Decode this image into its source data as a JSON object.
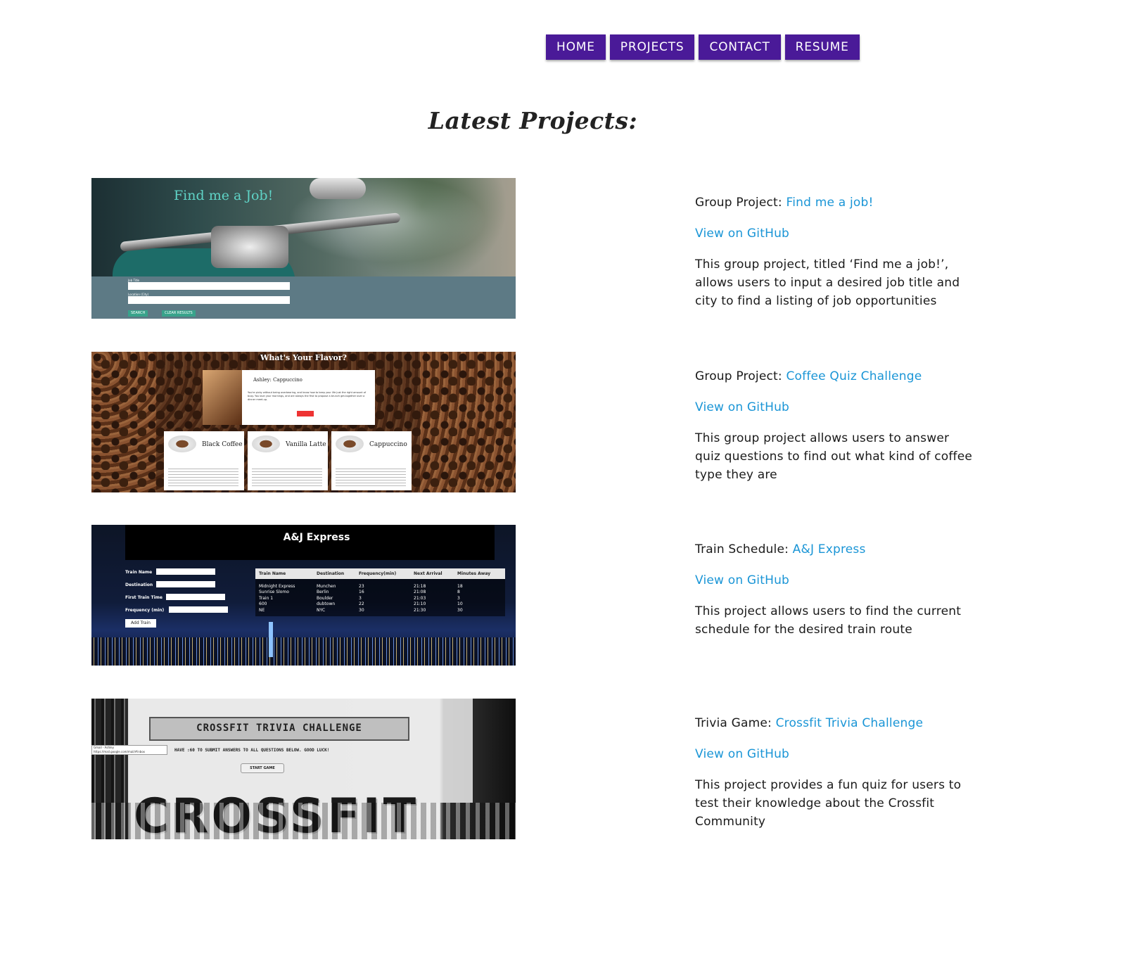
{
  "nav": {
    "home": "HOME",
    "projects": "PROJECTS",
    "contact": "CONTACT",
    "resume": "RESUME"
  },
  "page_title": "Latest Projects:",
  "projects": [
    {
      "prefix": "Group Project:",
      "name": "Find me a job!",
      "github": "View on GitHub",
      "description": "This group project, titled ‘Find me a job!’, allows users to input a desired job title and city to find a listing of job opportunities",
      "screenshot": {
        "title": "Find me a Job!",
        "label_job": "Job Title",
        "label_location": "Location (City)",
        "search": "SEARCH",
        "clear": "CLEAR RESULTS"
      }
    },
    {
      "prefix": "Group Project:",
      "name": "Coffee Quiz Challenge",
      "github": "View on GitHub",
      "description": "This group project allows users to answer quiz questions to find out what kind of coffee type they are",
      "screenshot": {
        "title": "What's Your Flavor?",
        "result_name": "Ashley: Cappuccino",
        "result_text": "You're picky without being overbearing, and know how to keep your life just the right amount of busy. You love your mornings, and are always the first to propose a brunch get-together over a dinner meet-up.",
        "cards": [
          "Black Coffee",
          "Vanilla Latte",
          "Cappuccino"
        ]
      }
    },
    {
      "prefix": "Train Schedule:",
      "name": "A&J Express",
      "github": "View on GitHub",
      "description": "This project allows users to find the current schedule for the desired train route",
      "screenshot": {
        "title": "A&J Express",
        "labels": [
          "Train Name",
          "Destination",
          "First Train Time",
          "Frequency (min)"
        ],
        "add_button": "Add Train",
        "columns": [
          "Train Name",
          "Destination",
          "Frequency(min)",
          "Next Arrival",
          "Minutes Away"
        ],
        "rows": [
          [
            "Midnight Express",
            "Munchen",
            "23",
            "21:18",
            "18"
          ],
          [
            "Sunrise Slomo",
            "Berlin",
            "16",
            "21:08",
            "8"
          ],
          [
            "Train 1",
            "Boulder",
            "3",
            "21:03",
            "3"
          ],
          [
            "600",
            "dubtown",
            "22",
            "21:10",
            "10"
          ],
          [
            "NE",
            "NYC",
            "30",
            "21:30",
            "30"
          ]
        ]
      }
    },
    {
      "prefix": "Trivia Game:",
      "name": "Crossfit Trivia Challenge",
      "github": "View on GitHub",
      "description": "This project provides a fun quiz for users to test their knowledge about the Crossfit Community",
      "screenshot": {
        "title": "CROSSFIT TRIVIA CHALLENGE",
        "subtitle": "HAVE :60 TO SUBMIT ANSWERS TO ALL QUESTIONS BELOW. GOOD LUCK!",
        "tooltip_line1": "Gmail - Ashley",
        "tooltip_line2": "https://mail.google.com/mail/#inbox",
        "start": "START GAME",
        "big_text": "CROSSFIT"
      }
    }
  ]
}
